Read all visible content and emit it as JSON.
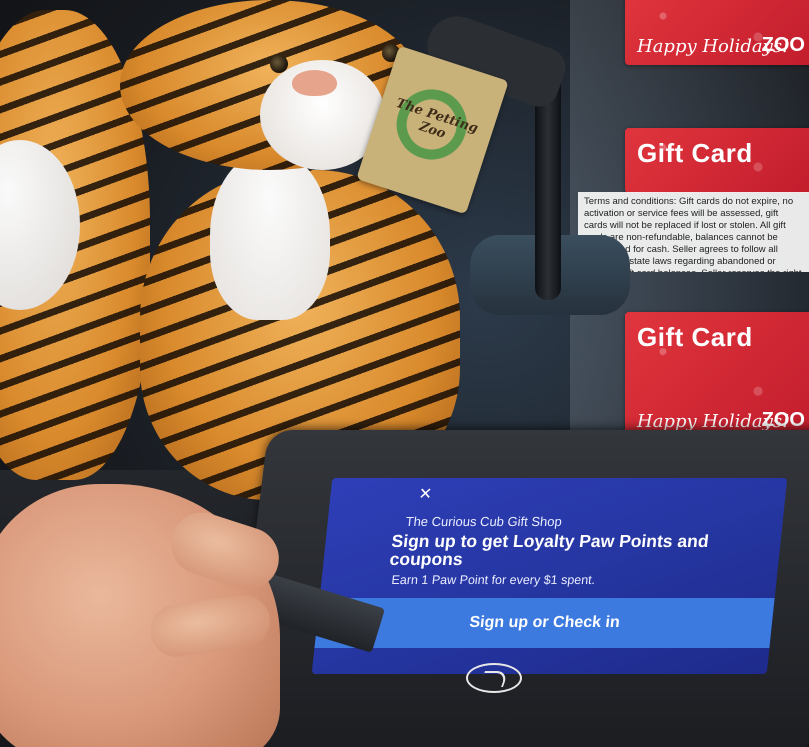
{
  "tag": {
    "brand": "The Petting Zoo"
  },
  "gift_cards": {
    "top": {
      "holiday_text": "Happy Holidays!",
      "brand_text": "ZOO"
    },
    "middle": {
      "title": "Gift Card"
    },
    "bottom": {
      "title": "Gift Card",
      "holiday_text": "Happy Holidays!",
      "brand_text": "ZOO"
    },
    "terms": "Terms and conditions: Gift cards do not expire, no activation or service fees will be assessed, gift cards will not be replaced if lost or stolen. All gift cards are non-refundable, balances cannot be exchanged for cash. Seller agrees to follow all applicable state laws regarding abandoned or dormant gift card balances. Seller reserves the right to revise these terms and conditions at any time."
  },
  "terminal": {
    "close_symbol": "✕",
    "shop_name": "The Curious Cub Gift Shop",
    "headline": "Sign up to get Loyalty Paw Points and coupons",
    "subline": "Earn 1 Paw Point for every $1 spent.",
    "button_label": "Sign up or Check in",
    "contactless_icon": "contactless-payment-icon"
  },
  "colors": {
    "screen": "#2535a0",
    "button": "#3d7ae0",
    "gift_card_red": "#d3262f",
    "tiger_orange": "#d98a2c"
  }
}
